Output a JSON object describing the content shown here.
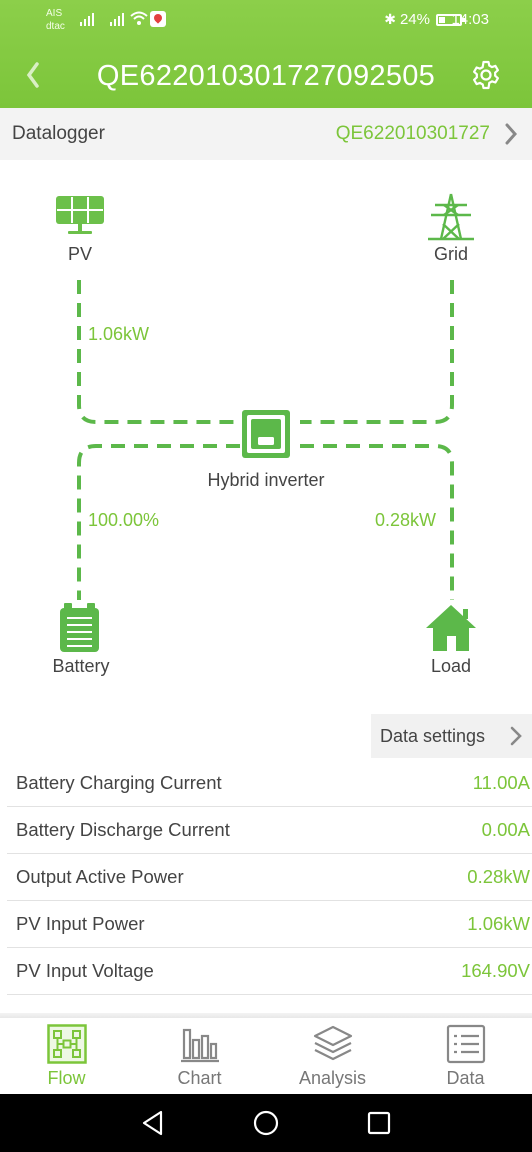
{
  "status_bar": {
    "carrier1": "AIS",
    "carrier2": "dtac",
    "battery_percent": "24%",
    "time": "14:03"
  },
  "header": {
    "back_icon": "chevron-left-icon",
    "title": "QE6220103017270925 05",
    "title_full": "QE622010301727092505",
    "settings_icon": "gear-icon"
  },
  "datalogger": {
    "label": "Datalogger",
    "value": "QE622010301727"
  },
  "flow": {
    "pv": {
      "label": "PV",
      "icon": "solar-panel-icon"
    },
    "grid": {
      "label": "Grid",
      "icon": "power-tower-icon"
    },
    "inverter": {
      "label": "Hybrid inverter",
      "icon": "inverter-icon"
    },
    "battery": {
      "label": "Battery",
      "icon": "battery-icon"
    },
    "load": {
      "label": "Load",
      "icon": "house-icon"
    },
    "pv_power": "1.06kW",
    "battery_soc": "100.00%",
    "load_power": "0.28kW",
    "accent_color": "#7cc53a"
  },
  "data_settings": {
    "label": "Data settings"
  },
  "rows": [
    {
      "label": "Battery Charging Current",
      "value": "11.00A"
    },
    {
      "label": "Battery Discharge Current",
      "value": "0.00A"
    },
    {
      "label": "Output Active Power",
      "value": "0.28kW"
    },
    {
      "label": "PV Input Power",
      "value": "1.06kW"
    },
    {
      "label": "PV Input Voltage",
      "value": "164.90V"
    }
  ],
  "tabs": [
    {
      "label": "Flow",
      "icon": "flow-icon",
      "active": true
    },
    {
      "label": "Chart",
      "icon": "bar-chart-icon",
      "active": false
    },
    {
      "label": "Analysis",
      "icon": "layers-icon",
      "active": false
    },
    {
      "label": "Data",
      "icon": "list-icon",
      "active": false
    }
  ]
}
